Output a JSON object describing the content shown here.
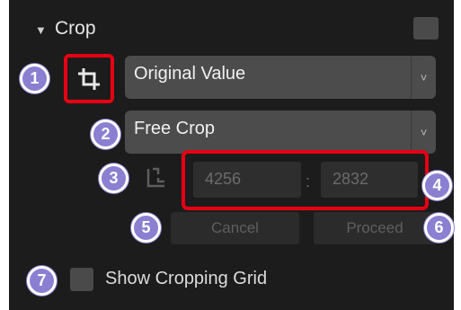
{
  "section": {
    "arrow": "▼",
    "title": "Crop"
  },
  "crop_ratio_dropdown": {
    "value": "Original Value",
    "chevron": "˅"
  },
  "crop_mode_dropdown": {
    "value": "Free Crop",
    "chevron": "˅"
  },
  "dimensions": {
    "width": "4256",
    "separator": ":",
    "height": "2832"
  },
  "buttons": {
    "cancel": "Cancel",
    "proceed": "Proceed"
  },
  "grid_option": {
    "label": "Show Cropping Grid",
    "checked": false
  },
  "callouts": [
    "1",
    "2",
    "3",
    "4",
    "5",
    "6",
    "7"
  ],
  "colors": {
    "callout": "#8a7fd1",
    "highlight": "#e60012",
    "panel": "#1c1c1c"
  },
  "icons": [
    "crop-icon",
    "swap-orientation-icon",
    "chevron-down-icon"
  ]
}
